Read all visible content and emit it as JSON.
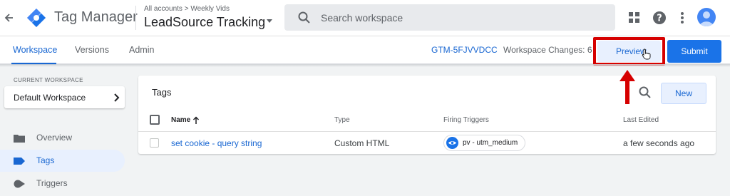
{
  "header": {
    "brand": "Tag Manager",
    "breadcrumb": "All accounts > Weekly Vids",
    "container_name": "LeadSource Tracking",
    "search_placeholder": "Search workspace"
  },
  "subnav": {
    "tabs": [
      {
        "label": "Workspace",
        "active": true
      },
      {
        "label": "Versions",
        "active": false
      },
      {
        "label": "Admin",
        "active": false
      }
    ],
    "container_id": "GTM-5FJVVDCC",
    "workspace_changes": "Workspace Changes: 6",
    "preview_label": "Preview",
    "submit_label": "Submit"
  },
  "sidebar": {
    "current_workspace_label": "CURRENT WORKSPACE",
    "workspace_name": "Default Workspace",
    "items": [
      {
        "label": "Overview",
        "icon": "folder-icon",
        "active": false
      },
      {
        "label": "Tags",
        "icon": "tag-icon",
        "active": true
      },
      {
        "label": "Triggers",
        "icon": "trigger-icon",
        "active": false
      }
    ]
  },
  "tags_card": {
    "title": "Tags",
    "new_label": "New",
    "columns": {
      "name": "Name",
      "type": "Type",
      "firing_triggers": "Firing Triggers",
      "last_edited": "Last Edited"
    },
    "rows": [
      {
        "name": "set cookie - query string",
        "type": "Custom HTML",
        "trigger": "pv - utm_medium",
        "last_edited": "a few seconds ago"
      }
    ]
  },
  "colors": {
    "accent": "#1a73e8",
    "link": "#1967d2",
    "highlight": "#d60000"
  }
}
